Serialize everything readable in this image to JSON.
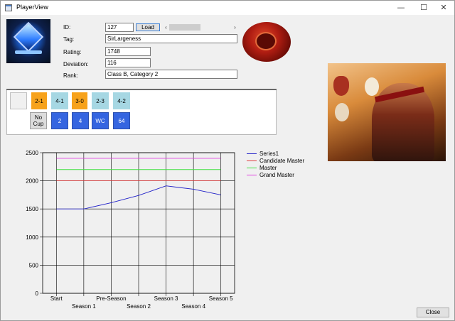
{
  "window": {
    "title": "PlayerView",
    "minimize_glyph": "—",
    "maximize_glyph": "☐",
    "close_glyph": "✕"
  },
  "form": {
    "id_label": "ID:",
    "id_value": "127",
    "load_label": "Load",
    "tag_label": "Tag:",
    "tag_value": "SirLargeness",
    "rating_label": "Rating:",
    "rating_value": "1748",
    "deviation_label": "Deviation:",
    "deviation_value": "116",
    "rank_label": "Rank:",
    "rank_value": "Class B, Category 2"
  },
  "scrollbar": {
    "left_arrow": "‹",
    "right_arrow": "›"
  },
  "results": {
    "row1": [
      {
        "label": "",
        "color": "#f0f0f0"
      },
      {
        "label": "2-1",
        "color": "#f7a21b"
      },
      {
        "label": "4-1",
        "color": "#a6d7e3"
      },
      {
        "label": "3-0",
        "color": "#f7a21b"
      },
      {
        "label": "2-3",
        "color": "#a6d7e3"
      },
      {
        "label": "4-2",
        "color": "#a6d7e3"
      }
    ],
    "row2": [
      {
        "label": "No Cup",
        "color": "#dcdcdc",
        "text_color": "#000000"
      },
      {
        "label": "2",
        "color": "#3565e0",
        "text_color": "#ffffff"
      },
      {
        "label": "4",
        "color": "#3565e0",
        "text_color": "#ffffff"
      },
      {
        "label": "WC",
        "color": "#3565e0",
        "text_color": "#ffffff"
      },
      {
        "label": "64",
        "color": "#3565e0",
        "text_color": "#ffffff"
      }
    ]
  },
  "chart_data": {
    "type": "line",
    "categories": [
      "Start",
      "Season 1",
      "Pre-Season",
      "Season 2",
      "Season 3",
      "Season 4",
      "Season 5"
    ],
    "ylim": [
      0,
      2500
    ],
    "yticks": [
      0,
      500,
      1000,
      1500,
      2000,
      2500
    ],
    "grid": true,
    "legend_position": "right",
    "series": [
      {
        "name": "Series1",
        "color": "#2020c8",
        "values": [
          1500,
          1500,
          1610,
          1740,
          1910,
          1850,
          1750
        ]
      },
      {
        "name": "Candidate Master",
        "color": "#e04040",
        "values": [
          2000,
          2000,
          2000,
          2000,
          2000,
          2000,
          2000
        ]
      },
      {
        "name": "Master",
        "color": "#40e040",
        "values": [
          2200,
          2200,
          2200,
          2200,
          2200,
          2200,
          2200
        ]
      },
      {
        "name": "Grand Master",
        "color": "#e040e0",
        "values": [
          2400,
          2400,
          2400,
          2400,
          2400,
          2400,
          2400
        ]
      }
    ]
  },
  "footer": {
    "close_label": "Close"
  }
}
